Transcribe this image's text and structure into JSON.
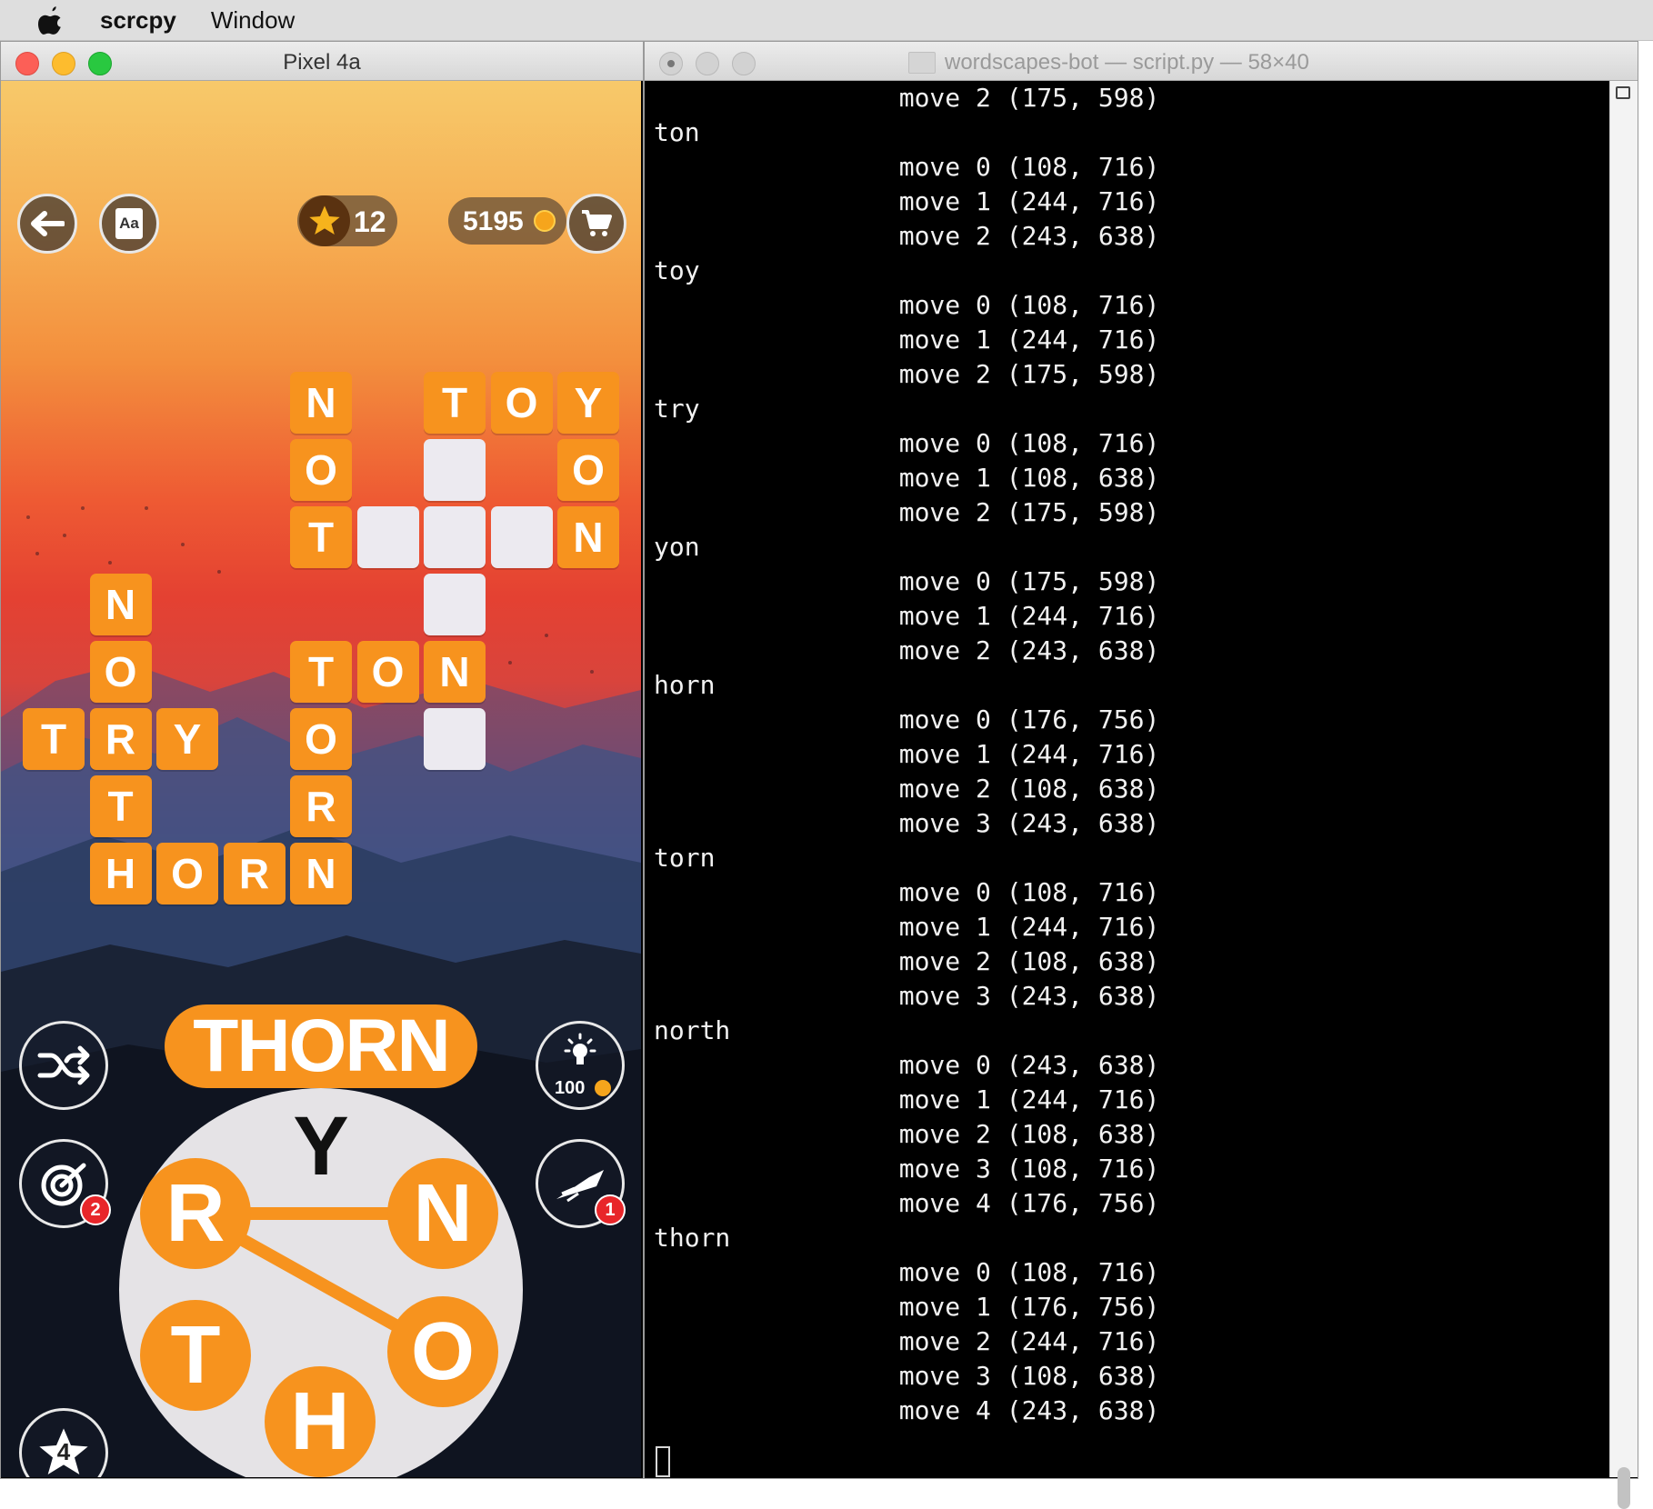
{
  "menubar": {
    "app_name": "scrcpy",
    "window_menu": "Window"
  },
  "phone_window": {
    "title": "Pixel 4a"
  },
  "game": {
    "stars": "12",
    "coins": "5195",
    "dictionary_icon_label": "Aa",
    "current_word": "THORN",
    "hint_cost": "100",
    "target_badge": "2",
    "rocket_badge": "1",
    "star_bonus": "4",
    "wheel_letters": {
      "top": "Y",
      "left": "R",
      "right": "N",
      "bottom_left": "T",
      "bottom_right": "O",
      "bottom": "H"
    },
    "colors": {
      "tile": "#f7931e",
      "empty_tile": "#eceaf0",
      "badge": "#e8262a"
    },
    "board_tiles": [
      {
        "letter": "N"
      },
      {
        "letter": "T"
      },
      {
        "letter": "O"
      },
      {
        "letter": "Y"
      },
      {
        "letter": "O"
      },
      {
        "letter": ""
      },
      {
        "letter": "O"
      },
      {
        "letter": "T"
      },
      {
        "letter": ""
      },
      {
        "letter": ""
      },
      {
        "letter": ""
      },
      {
        "letter": "N"
      },
      {
        "letter": "N"
      },
      {
        "letter": ""
      },
      {
        "letter": "O"
      },
      {
        "letter": "T"
      },
      {
        "letter": "O"
      },
      {
        "letter": "N"
      },
      {
        "letter": "T"
      },
      {
        "letter": "R"
      },
      {
        "letter": "Y"
      },
      {
        "letter": "O"
      },
      {
        "letter": ""
      },
      {
        "letter": "T"
      },
      {
        "letter": "R"
      },
      {
        "letter": "H"
      },
      {
        "letter": "O"
      },
      {
        "letter": "R"
      },
      {
        "letter": "N"
      }
    ]
  },
  "terminal": {
    "title": "wordscapes-bot — script.py — 58×40",
    "lines": [
      "\tmove 2 (175, 598)",
      "ton",
      "\tmove 0 (108, 716)",
      "\tmove 1 (244, 716)",
      "\tmove 2 (243, 638)",
      "toy",
      "\tmove 0 (108, 716)",
      "\tmove 1 (244, 716)",
      "\tmove 2 (175, 598)",
      "try",
      "\tmove 0 (108, 716)",
      "\tmove 1 (108, 638)",
      "\tmove 2 (175, 598)",
      "yon",
      "\tmove 0 (175, 598)",
      "\tmove 1 (244, 716)",
      "\tmove 2 (243, 638)",
      "horn",
      "\tmove 0 (176, 756)",
      "\tmove 1 (244, 716)",
      "\tmove 2 (108, 638)",
      "\tmove 3 (243, 638)",
      "torn",
      "\tmove 0 (108, 716)",
      "\tmove 1 (244, 716)",
      "\tmove 2 (108, 638)",
      "\tmove 3 (243, 638)",
      "north",
      "\tmove 0 (243, 638)",
      "\tmove 1 (244, 716)",
      "\tmove 2 (108, 638)",
      "\tmove 3 (108, 716)",
      "\tmove 4 (176, 756)",
      "thorn",
      "\tmove 0 (108, 716)",
      "\tmove 1 (176, 756)",
      "\tmove 2 (244, 716)",
      "\tmove 3 (108, 638)",
      "\tmove 4 (243, 638)"
    ]
  }
}
